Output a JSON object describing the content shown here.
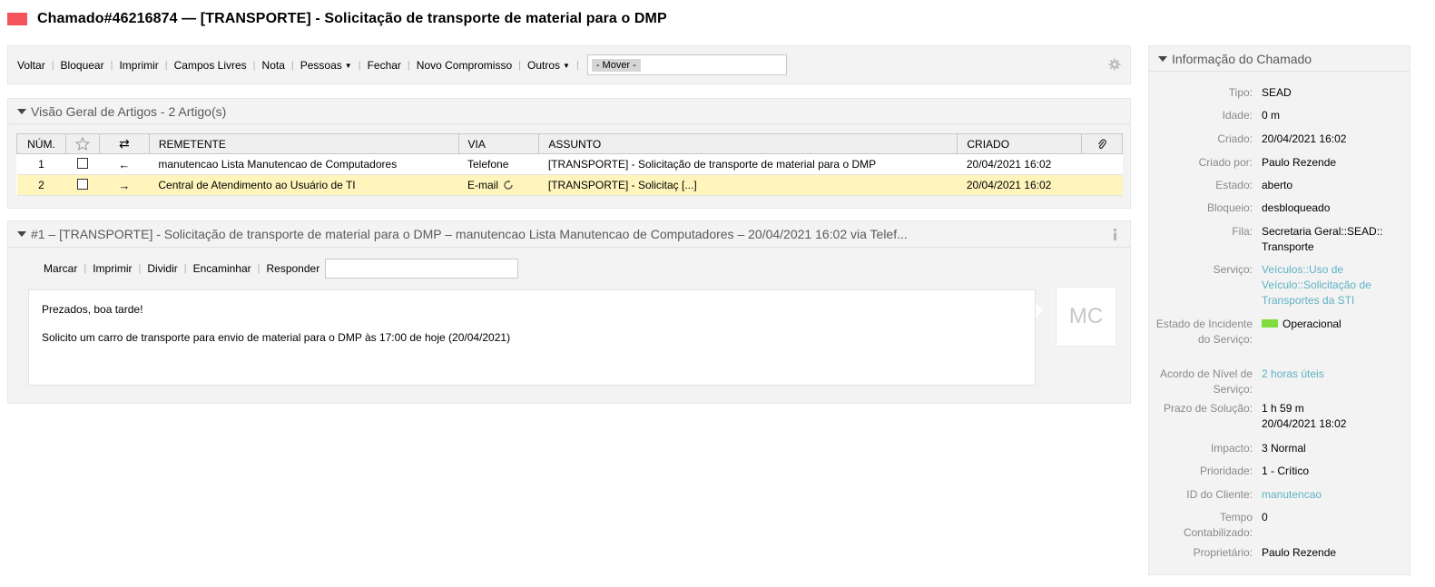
{
  "ticket": {
    "priority_color": "#f4545c",
    "title": "Chamado#46216874 — [TRANSPORTE] - Solicitação de transporte de material para o DMP"
  },
  "toolbar": {
    "items": [
      "Voltar",
      "Bloquear",
      "Imprimir",
      "Campos Livres",
      "Nota",
      "Pessoas",
      "Fechar",
      "Novo Compromisso",
      "Outros"
    ],
    "move_placeholder": "- Mover -",
    "settings_icon": "gear-icon"
  },
  "overview": {
    "header": "Visão Geral de Artigos - 2 Artigo(s)",
    "columns": {
      "num": "NÚM.",
      "star": "star-icon",
      "direction": "direction-icon",
      "sender": "REMETENTE",
      "via": "VIA",
      "subject": "ASSUNTO",
      "created": "CRIADO",
      "attachment": "paperclip-icon"
    },
    "rows": [
      {
        "num": "1",
        "direction": "←",
        "sender": "manutencao Lista Manutencao de Computadores",
        "via": "Telefone",
        "subject": "[TRANSPORTE] - Solicitação de transporte de material para o DMP",
        "created": "20/04/2021 16:02"
      },
      {
        "num": "2",
        "direction": "→",
        "sender": "Central de Atendimento ao Usuário de TI",
        "via": "E-mail",
        "subject": "[TRANSPORTE] - Solicitaç [...]",
        "created": "20/04/2021 16:02"
      }
    ],
    "selected_row_color": "#fff5bc"
  },
  "article": {
    "header": "#1 – [TRANSPORTE] - Solicitação de transporte de material para o DMP – manutencao Lista Manutencao de Computadores – 20/04/2021 16:02 via Telef...",
    "actions": [
      "Marcar",
      "Imprimir",
      "Dividir",
      "Encaminhar",
      "Responder"
    ],
    "body": [
      "Prezados, boa tarde!",
      "Solicito um carro de transporte para envio de material para o DMP às 17:00 de hoje (20/04/2021)"
    ],
    "avatar_initials": "MC"
  },
  "sidebar": {
    "header": "Informação do Chamado",
    "fields": [
      {
        "label": "Tipo:",
        "value": "SEAD"
      },
      {
        "label": "Idade:",
        "value": "0 m"
      },
      {
        "label": "Criado:",
        "value": "20/04/2021 16:02"
      },
      {
        "label": "Criado por:",
        "value": "Paulo Rezende"
      },
      {
        "label": "Estado:",
        "value": "aberto"
      },
      {
        "label": "Bloqueio:",
        "value": "desbloqueado"
      },
      {
        "label": "Fila:",
        "value": "Secretaria Geral::SEAD:: Transporte"
      },
      {
        "label": "Serviço:",
        "value": "Veículos::Uso de Veículo::Solicitação de Transportes da STI"
      },
      {
        "label": "Estado de Incidente do Serviço:",
        "value": "Operacional"
      },
      {
        "label": "Acordo de Nível de Serviço:",
        "value": "2 horas úteis"
      },
      {
        "label": "Prazo de Solução:",
        "value": "1 h 59 m",
        "value2": "20/04/2021 18:02"
      },
      {
        "label": "Impacto:",
        "value": "3 Normal"
      },
      {
        "label": "Prioridade:",
        "value": "1 - Crítico"
      },
      {
        "label": "ID do Cliente:",
        "value": "manutencao"
      },
      {
        "label": "Tempo Contabilizado:",
        "value": "0"
      },
      {
        "label": "Proprietário:",
        "value": "Paulo Rezende"
      }
    ],
    "incident_color": "#7edc3c",
    "link_color": "#5fb2c4"
  }
}
